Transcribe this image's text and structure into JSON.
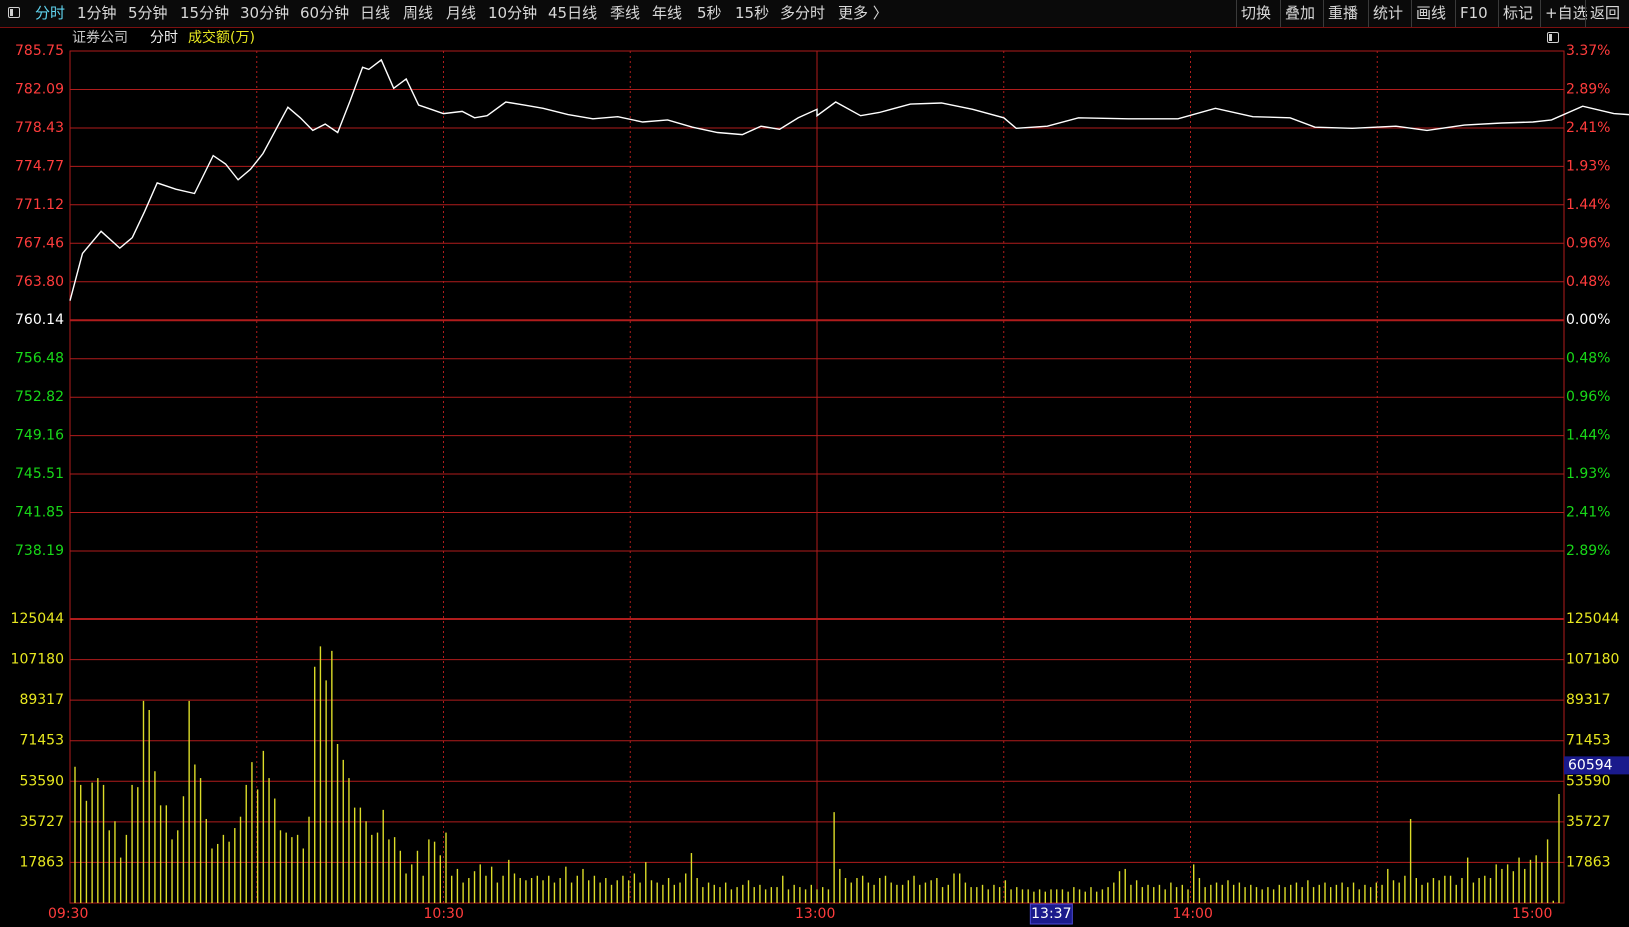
{
  "toolbar": {
    "period_tabs": [
      "分时",
      "1分钟",
      "5分钟",
      "15分钟",
      "30分钟",
      "60分钟",
      "日线",
      "周线",
      "月线",
      "10分钟",
      "45日线",
      "季线",
      "年线",
      "5秒",
      "15秒",
      "多分时",
      "更多 〉"
    ],
    "active_tab": "分时",
    "right_buttons": [
      "切换",
      "叠加",
      "重播",
      "统计",
      "画线",
      "F10",
      "标记",
      "+自选",
      "返回"
    ]
  },
  "header": {
    "stock_name": "证券公司",
    "chart_mode": "分时",
    "volume_label": "成交额(万)"
  },
  "colors": {
    "background": "#000000",
    "grid": "#b01c1c",
    "up": "#ff3c3c",
    "down": "#18d818",
    "neutral": "#ffffff",
    "price_line": "#ffffff",
    "volume_bar": "#dcdc28",
    "volume_label": "#e8e820",
    "time_label": "#ff3c3c",
    "cursor_box": "#1a1a8c"
  },
  "chart_data": {
    "type": "line",
    "price_panel": {
      "prev_close": 760.14,
      "y_range": [
        738.19,
        785.75
      ],
      "left_ticks": [
        "785.75",
        "782.09",
        "778.43",
        "774.77",
        "771.12",
        "767.46",
        "763.80",
        "760.14",
        "756.48",
        "752.82",
        "749.16",
        "745.51",
        "741.85",
        "738.19"
      ],
      "right_ticks": [
        "3.37%",
        "2.89%",
        "2.41%",
        "1.93%",
        "1.44%",
        "0.96%",
        "0.48%",
        "0.00%",
        "0.48%",
        "0.96%",
        "1.44%",
        "1.93%",
        "2.41%",
        "2.89%"
      ],
      "series": [
        {
          "x": "09:30",
          "y": 762.0
        },
        {
          "x": "09:32",
          "y": 766.5
        },
        {
          "x": "09:35",
          "y": 768.6
        },
        {
          "x": "09:38",
          "y": 767.0
        },
        {
          "x": "09:40",
          "y": 768.0
        },
        {
          "x": "09:42",
          "y": 770.5
        },
        {
          "x": "09:44",
          "y": 773.2
        },
        {
          "x": "09:47",
          "y": 772.6
        },
        {
          "x": "09:50",
          "y": 772.2
        },
        {
          "x": "09:53",
          "y": 775.8
        },
        {
          "x": "09:55",
          "y": 775.0
        },
        {
          "x": "09:57",
          "y": 773.5
        },
        {
          "x": "09:59",
          "y": 774.5
        },
        {
          "x": "10:01",
          "y": 776.0
        },
        {
          "x": "10:03",
          "y": 778.2
        },
        {
          "x": "10:05",
          "y": 780.4
        },
        {
          "x": "10:07",
          "y": 779.4
        },
        {
          "x": "10:09",
          "y": 778.2
        },
        {
          "x": "10:11",
          "y": 778.8
        },
        {
          "x": "10:13",
          "y": 778.0
        },
        {
          "x": "10:15",
          "y": 781.0
        },
        {
          "x": "10:17",
          "y": 784.2
        },
        {
          "x": "10:18",
          "y": 784.0
        },
        {
          "x": "10:20",
          "y": 784.9
        },
        {
          "x": "10:22",
          "y": 782.2
        },
        {
          "x": "10:24",
          "y": 783.1
        },
        {
          "x": "10:26",
          "y": 780.6
        },
        {
          "x": "10:28",
          "y": 780.2
        },
        {
          "x": "10:30",
          "y": 779.8
        },
        {
          "x": "10:33",
          "y": 780.0
        },
        {
          "x": "10:35",
          "y": 779.4
        },
        {
          "x": "10:37",
          "y": 779.6
        },
        {
          "x": "10:40",
          "y": 780.9
        },
        {
          "x": "10:43",
          "y": 780.6
        },
        {
          "x": "10:46",
          "y": 780.3
        },
        {
          "x": "10:50",
          "y": 779.7
        },
        {
          "x": "10:54",
          "y": 779.3
        },
        {
          "x": "10:58",
          "y": 779.5
        },
        {
          "x": "11:02",
          "y": 779.0
        },
        {
          "x": "11:06",
          "y": 779.2
        },
        {
          "x": "11:10",
          "y": 778.5
        },
        {
          "x": "11:14",
          "y": 778.0
        },
        {
          "x": "11:18",
          "y": 777.8
        },
        {
          "x": "11:21",
          "y": 778.6
        },
        {
          "x": "11:24",
          "y": 778.3
        },
        {
          "x": "11:27",
          "y": 779.4
        },
        {
          "x": "11:30",
          "y": 780.2
        },
        {
          "x": "13:00",
          "y": 779.6
        },
        {
          "x": "13:03",
          "y": 780.9
        },
        {
          "x": "13:07",
          "y": 779.6
        },
        {
          "x": "13:10",
          "y": 779.9
        },
        {
          "x": "13:15",
          "y": 780.7
        },
        {
          "x": "13:20",
          "y": 780.8
        },
        {
          "x": "13:25",
          "y": 780.2
        },
        {
          "x": "13:30",
          "y": 779.4
        },
        {
          "x": "13:32",
          "y": 778.4
        },
        {
          "x": "13:37",
          "y": 778.6
        },
        {
          "x": "13:42",
          "y": 779.4
        },
        {
          "x": "13:50",
          "y": 779.3
        },
        {
          "x": "13:58",
          "y": 779.3
        },
        {
          "x": "14:04",
          "y": 780.3
        },
        {
          "x": "14:10",
          "y": 779.5
        },
        {
          "x": "14:16",
          "y": 779.4
        },
        {
          "x": "14:20",
          "y": 778.5
        },
        {
          "x": "14:26",
          "y": 778.4
        },
        {
          "x": "14:33",
          "y": 778.6
        },
        {
          "x": "14:38",
          "y": 778.2
        },
        {
          "x": "14:44",
          "y": 778.7
        },
        {
          "x": "14:50",
          "y": 778.9
        },
        {
          "x": "14:55",
          "y": 779.0
        },
        {
          "x": "14:58",
          "y": 779.2
        },
        {
          "x": "15:03",
          "y": 780.5
        },
        {
          "x": "15:08",
          "y": 779.8
        },
        {
          "x": "15:13",
          "y": 779.6
        },
        {
          "x": "15:18",
          "y": 779.2
        },
        {
          "x": "15:23",
          "y": 779.5
        },
        {
          "x": "15:30",
          "y": 779.7
        },
        {
          "x": "15:36",
          "y": 780.0
        },
        {
          "x": "15:42",
          "y": 779.8
        },
        {
          "x": "15:48",
          "y": 780.1
        },
        {
          "x": "15:55",
          "y": 780.0
        },
        {
          "x": "16:00",
          "y": 779.8
        }
      ]
    },
    "volume_panel": {
      "y_range": [
        0,
        125044
      ],
      "ticks": [
        "125044",
        "107180",
        "89317",
        "71453",
        "53590",
        "35727",
        "17863"
      ],
      "right_ticks": [
        "125044",
        "107180",
        "89317",
        "71453",
        "53590",
        "35727",
        "17863"
      ],
      "cursor_value": "60594",
      "values": [
        60000,
        52000,
        45000,
        53000,
        55000,
        52000,
        32000,
        36000,
        20000,
        30000,
        52000,
        51000,
        89000,
        85000,
        58000,
        43000,
        43000,
        28000,
        32000,
        47000,
        89000,
        61000,
        55000,
        37000,
        24000,
        26000,
        30000,
        27000,
        33000,
        38000,
        52000,
        62000,
        50000,
        67000,
        55000,
        46000,
        32000,
        31000,
        29000,
        30000,
        24000,
        38000,
        104000,
        113000,
        98000,
        111000,
        70000,
        63000,
        55000,
        42000,
        42000,
        36000,
        30000,
        31000,
        41000,
        28000,
        29000,
        23000,
        13000,
        17000,
        23000,
        12000,
        28000,
        27000,
        21000,
        31000,
        12000,
        15000,
        9000,
        11000,
        14000,
        17000,
        12000,
        16000,
        9000,
        12000,
        19000,
        13000,
        11000,
        10000,
        11000,
        12000,
        10000,
        12000,
        9000,
        11000,
        16000,
        9000,
        12000,
        15000,
        10000,
        12000,
        9000,
        11000,
        8000,
        10000,
        12000,
        10000,
        13000,
        9000,
        18000,
        10000,
        9000,
        8000,
        11000,
        8000,
        9000,
        13000,
        22000,
        11000,
        7000,
        9000,
        8000,
        7000,
        9000,
        6000,
        7000,
        8000,
        10000,
        7000,
        8000,
        6000,
        7000,
        7000,
        12000,
        6000,
        8000,
        7000,
        6000,
        8000,
        6000,
        7000,
        6000,
        40000,
        15000,
        11000,
        9000,
        11000,
        12000,
        9000,
        8000,
        11000,
        12000,
        9000,
        8000,
        8000,
        10000,
        12000,
        8000,
        9000,
        10000,
        11000,
        7000,
        8000,
        13000,
        13000,
        9000,
        7000,
        7000,
        8000,
        6000,
        8000,
        7000,
        10000,
        6000,
        7000,
        6000,
        6000,
        5000,
        6000,
        5000,
        6000,
        6000,
        6000,
        5000,
        7000,
        6000,
        5000,
        7000,
        5000,
        6000,
        7000,
        9000,
        14000,
        15000,
        8000,
        10000,
        7000,
        8000,
        7000,
        8000,
        6000,
        9000,
        7000,
        8000,
        6000,
        17000,
        11000,
        7000,
        8000,
        9000,
        8000,
        10000,
        8000,
        9000,
        7000,
        8000,
        7000,
        6000,
        7000,
        6000,
        8000,
        7000,
        8000,
        9000,
        7000,
        10000,
        7000,
        8000,
        9000,
        7000,
        8000,
        9000,
        7000,
        9000,
        6000,
        8000,
        7000,
        9000,
        8000,
        15000,
        10000,
        9000,
        12000,
        37000,
        11000,
        8000,
        9000,
        11000,
        10000,
        12000,
        12000,
        8000,
        11000,
        20000,
        9000,
        11000,
        12000,
        11000,
        17000,
        15000,
        17000,
        14000,
        20000,
        15000,
        19000,
        21000,
        18000,
        28000,
        1000,
        48000
      ]
    },
    "x_ticks": [
      "09:30",
      "10:30",
      "13:00",
      "14:00",
      "15:00"
    ],
    "cursor_time": "13:37"
  }
}
